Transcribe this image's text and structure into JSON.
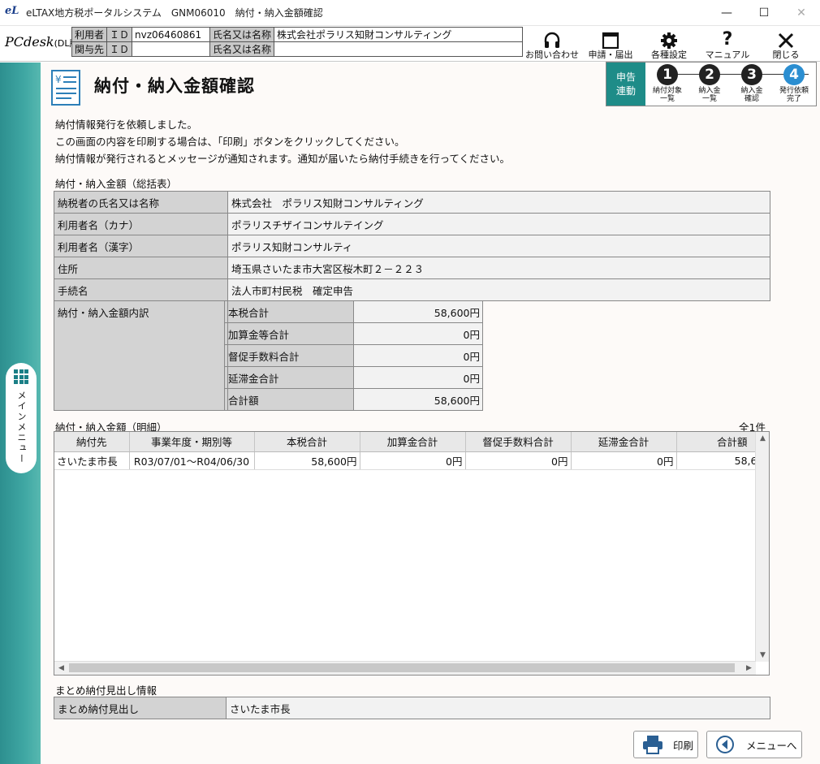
{
  "window": {
    "title": "eLTAX地方税ポータルシステム　GNM06010　納付・納入金額確認",
    "logo_text": "eL",
    "minimize": "—",
    "maximize": "☐",
    "close": "✕"
  },
  "header": {
    "brand": "PCdesk",
    "brand_suffix": "(DL版)",
    "user_row": {
      "label": "利用者",
      "id_label": "ＩＤ",
      "id_value": "nvz06460861",
      "name_label": "氏名又は名称",
      "name_value": "株式会社ポラリス知財コンサルティング"
    },
    "agent_row": {
      "label": "関与先",
      "id_label": "ＩＤ",
      "id_value": "",
      "name_label": "氏名又は名称",
      "name_value": ""
    },
    "tools": [
      {
        "label": "お問い合わせ",
        "icon": "headset-icon"
      },
      {
        "label": "申請・届出",
        "icon": "window-icon"
      },
      {
        "label": "各種設定",
        "icon": "gear-icon"
      },
      {
        "label": "マニュアル",
        "icon": "question-icon"
      },
      {
        "label": "閉じる",
        "icon": "close-icon"
      }
    ]
  },
  "sidebar": {
    "main_menu": "メインメニュー"
  },
  "page": {
    "title": "納付・納入金額確認",
    "steps": {
      "link": "申告\n連動",
      "items": [
        {
          "num": "1",
          "label": "納付対象\n一覧"
        },
        {
          "num": "2",
          "label": "納入金\n一覧"
        },
        {
          "num": "3",
          "label": "納入金\n確認"
        },
        {
          "num": "4",
          "label": "発行依頼\n完了"
        }
      ]
    },
    "messages": [
      "納付情報発行を依頼しました。",
      "この画面の内容を印刷する場合は、「印刷」ボタンをクリックしてください。",
      "納付情報が発行されるとメッセージが通知されます。通知が届いたら納付手続きを行ってください。"
    ],
    "summary": {
      "heading": "納付・納入金額（総括表）",
      "rows": [
        {
          "key": "納税者の氏名又は名称",
          "value": "株式会社　ポラリス知財コンサルティング"
        },
        {
          "key": "利用者名（カナ）",
          "value": "ポラリスチザイコンサルテイング"
        },
        {
          "key": "利用者名（漢字）",
          "value": "ポラリス知財コンサルティ"
        },
        {
          "key": "住所",
          "value": "埼玉県さいたま市大宮区桜木町２－２２３"
        },
        {
          "key": "手続名",
          "value": "法人市町村民税　確定申告"
        }
      ],
      "breakdown_label": "納付・納入金額内訳",
      "breakdown": [
        {
          "key": "本税合計",
          "value": "58,600円"
        },
        {
          "key": "加算金等合計",
          "value": "0円"
        },
        {
          "key": "督促手数料合計",
          "value": "0円"
        },
        {
          "key": "延滞金合計",
          "value": "0円"
        },
        {
          "key": "合計額",
          "value": "58,600円"
        }
      ]
    },
    "detail": {
      "heading": "納付・納入金額（明細）",
      "count": "全1件",
      "columns": [
        "納付先",
        "事業年度・期別等",
        "本税合計",
        "加算金合計",
        "督促手数料合計",
        "延滞金合計",
        "合計額"
      ],
      "rows": [
        [
          "さいたま市長",
          "R03/07/01～R04/06/30",
          "58,600円",
          "0円",
          "0円",
          "0円",
          "58,6"
        ]
      ]
    },
    "matome": {
      "heading": "まとめ納付見出し情報",
      "key": "まとめ納付見出し",
      "value": "さいたま市長"
    },
    "buttons": {
      "print": "印刷",
      "menu": "メニューへ"
    }
  }
}
